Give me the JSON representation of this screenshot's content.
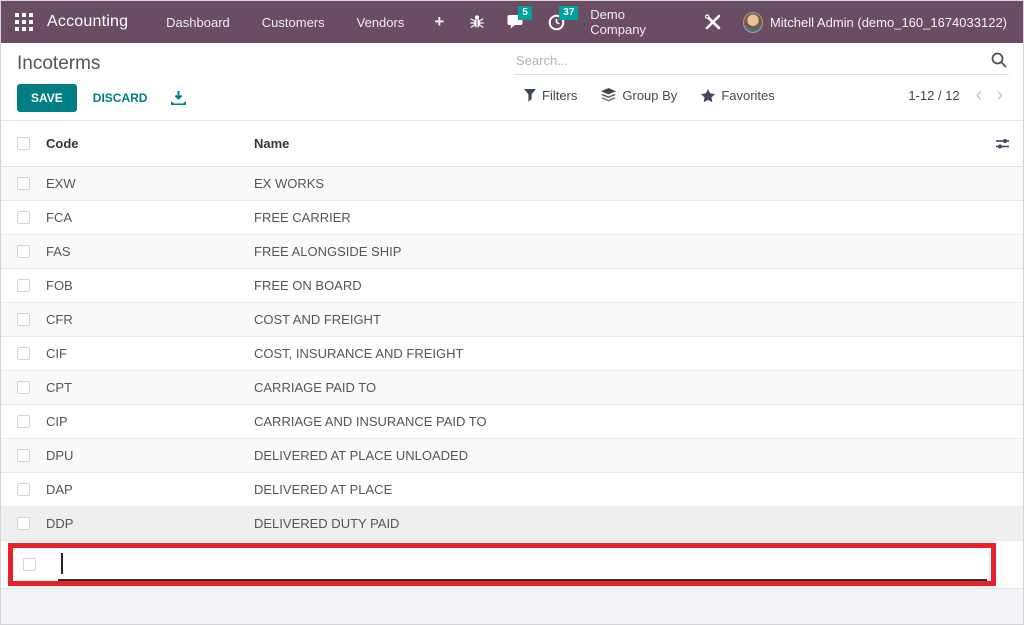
{
  "navbar": {
    "app_name": "Accounting",
    "menu": {
      "dashboard": "Dashboard",
      "customers": "Customers",
      "vendors": "Vendors",
      "plus": "+"
    },
    "messages_badge": "5",
    "activities_badge": "37",
    "company": "Demo Company",
    "user": "Mitchell Admin (demo_160_1674033122)",
    "bg_color": "#6b4d63",
    "badge_color": "#00a09d"
  },
  "control_panel": {
    "title": "Incoterms",
    "save_label": "SAVE",
    "discard_label": "DISCARD",
    "export_icon": "download-icon",
    "search_placeholder": "Search...",
    "filters_label": "Filters",
    "group_by_label": "Group By",
    "favorites_label": "Favorites",
    "pager_text": "1-12 / 12",
    "pager_prev": "‹",
    "pager_next": "›",
    "accent_color": "#017e84"
  },
  "table": {
    "columns": {
      "code": "Code",
      "name": "Name"
    },
    "rows": [
      {
        "code": "EXW",
        "name": "EX WORKS"
      },
      {
        "code": "FCA",
        "name": "FREE CARRIER"
      },
      {
        "code": "FAS",
        "name": "FREE ALONGSIDE SHIP"
      },
      {
        "code": "FOB",
        "name": "FREE ON BOARD"
      },
      {
        "code": "CFR",
        "name": "COST AND FREIGHT"
      },
      {
        "code": "CIF",
        "name": "COST, INSURANCE AND FREIGHT"
      },
      {
        "code": "CPT",
        "name": "CARRIAGE PAID TO"
      },
      {
        "code": "CIP",
        "name": "CARRIAGE AND INSURANCE PAID TO"
      },
      {
        "code": "DPU",
        "name": "DELIVERED AT PLACE UNLOADED"
      },
      {
        "code": "DAP",
        "name": "DELIVERED AT PLACE"
      },
      {
        "code": "DDP",
        "name": "DELIVERED DUTY PAID"
      }
    ],
    "new_row": {
      "code_value": "",
      "name_value": "",
      "highlight_color": "#e8212b"
    }
  }
}
